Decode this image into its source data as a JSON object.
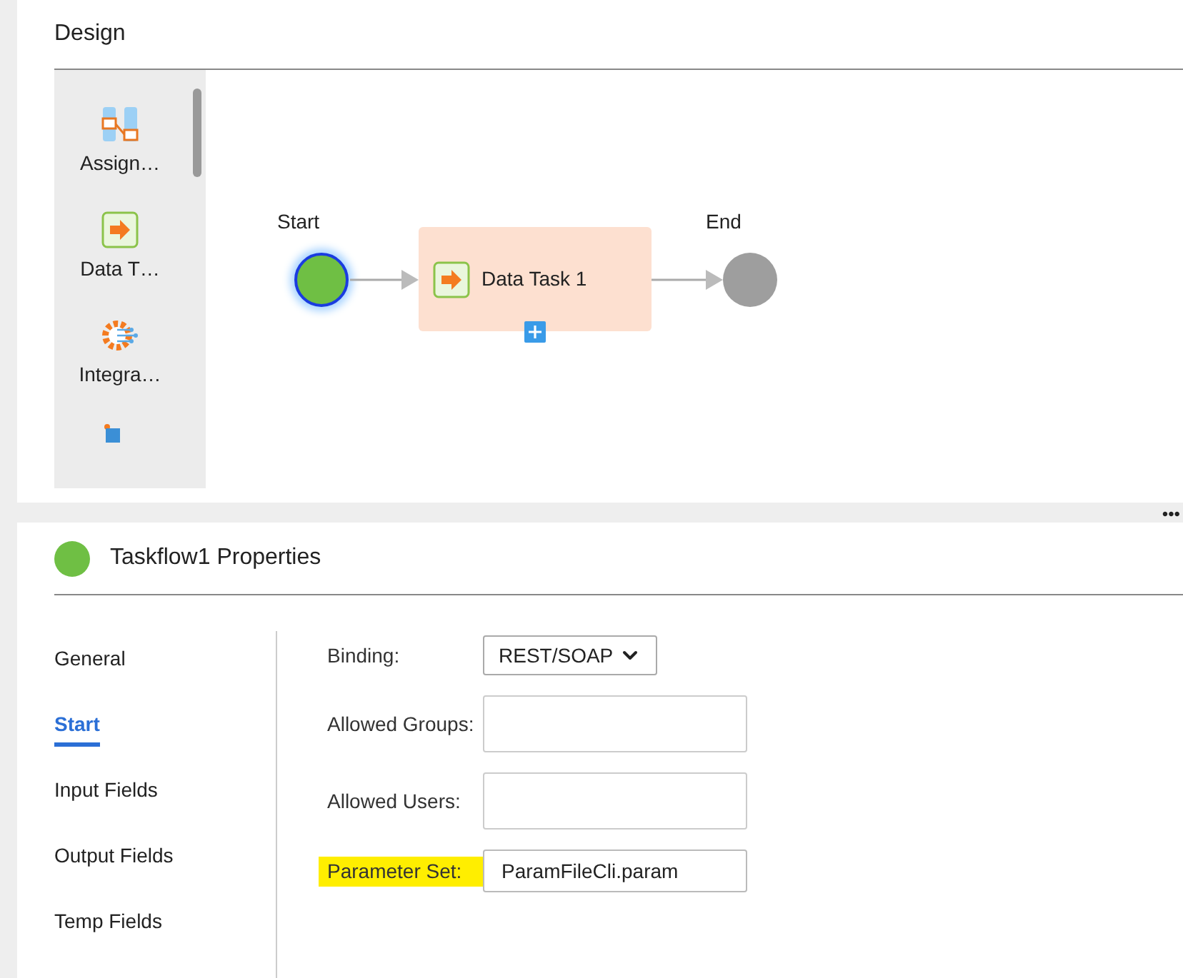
{
  "design": {
    "title": "Design",
    "palette": [
      {
        "label": "Assign…",
        "kind": "assign"
      },
      {
        "label": "Data T…",
        "kind": "data"
      },
      {
        "label": "Integra…",
        "kind": "integration"
      }
    ],
    "diagram": {
      "start_label": "Start",
      "task_label": "Data Task 1",
      "end_label": "End"
    }
  },
  "more": "•••",
  "properties": {
    "title": "Taskflow1 Properties",
    "nav": [
      {
        "label": "General",
        "selected": false
      },
      {
        "label": "Start",
        "selected": true
      },
      {
        "label": "Input Fields",
        "selected": false
      },
      {
        "label": "Output Fields",
        "selected": false
      },
      {
        "label": "Temp Fields",
        "selected": false
      }
    ],
    "fields": [
      {
        "label": "Binding:",
        "kind": "select",
        "value": "REST/SOAP",
        "highlighted": false
      },
      {
        "label": "Allowed Groups:",
        "kind": "text",
        "highlighted": false
      },
      {
        "label": "Allowed Users:",
        "kind": "text",
        "highlighted": false
      },
      {
        "label": "Parameter Set:",
        "kind": "input",
        "value": "ParamFileCli.param",
        "highlighted": true
      }
    ]
  }
}
